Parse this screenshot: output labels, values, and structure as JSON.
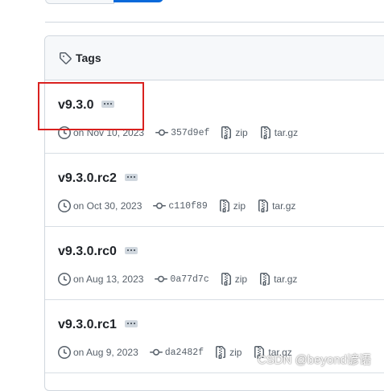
{
  "header": {
    "title": "Tags"
  },
  "tags": [
    {
      "name": "v9.3.0",
      "date": "on Nov 10, 2023",
      "commit": "357d9ef",
      "zip_label": "zip",
      "targz_label": "tar.gz"
    },
    {
      "name": "v9.3.0.rc2",
      "date": "on Oct 30, 2023",
      "commit": "c110f89",
      "zip_label": "zip",
      "targz_label": "tar.gz"
    },
    {
      "name": "v9.3.0.rc0",
      "date": "on Aug 13, 2023",
      "commit": "0a77d7c",
      "zip_label": "zip",
      "targz_label": "tar.gz"
    },
    {
      "name": "v9.3.0.rc1",
      "date": "on Aug 9, 2023",
      "commit": "da2482f",
      "zip_label": "zip",
      "targz_label": "tar.gz"
    }
  ],
  "watermark": "CSDN @beyond谚语",
  "colors": {
    "accent": "#0969da",
    "highlight_box": "#d9211f",
    "muted_text": "#57606a",
    "border": "#d0d7de"
  },
  "icons": {
    "header": "tag-icon",
    "date": "clock-icon",
    "commit": "commit-icon",
    "archive": "file-zip-icon",
    "menu": "kebab-horizontal-icon"
  }
}
